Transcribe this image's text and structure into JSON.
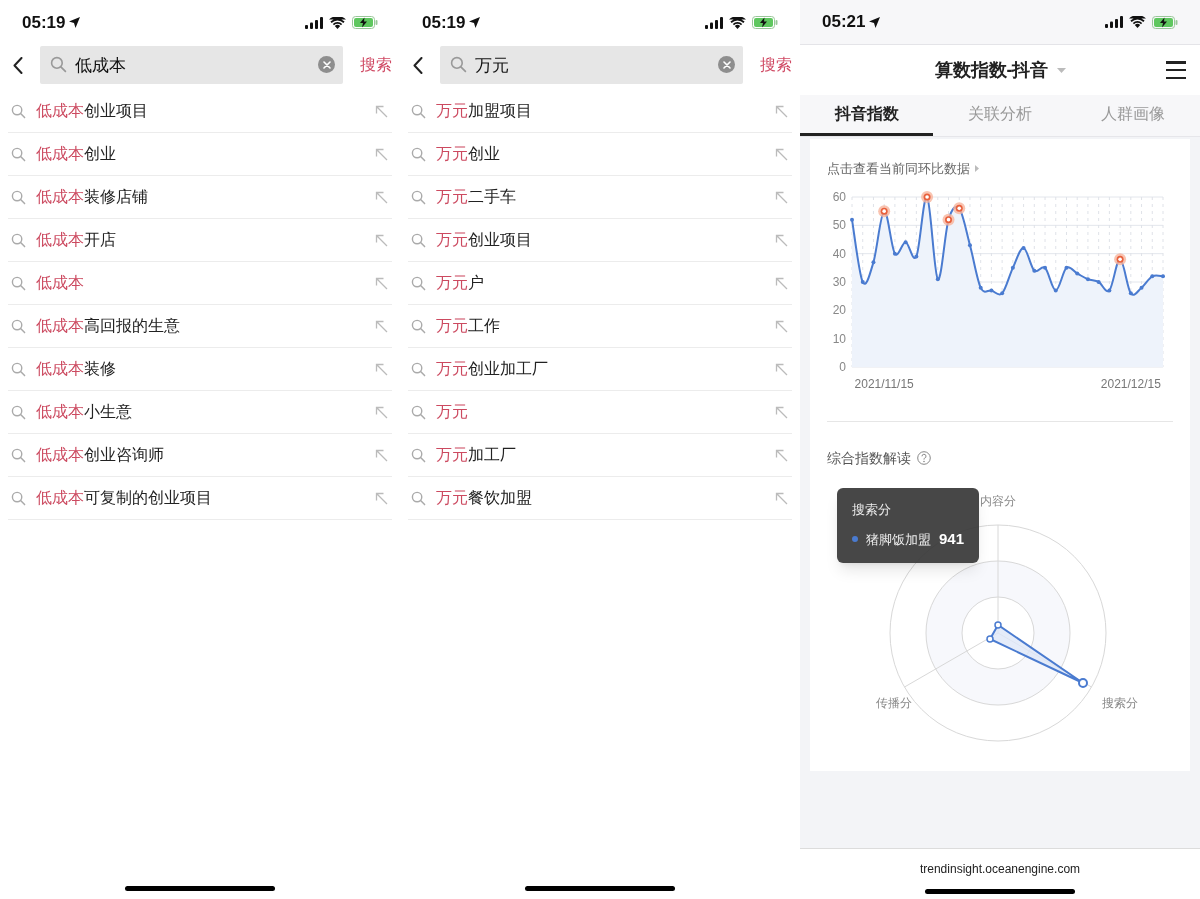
{
  "screens": [
    {
      "kind": "search",
      "status_bar": {
        "time": "05:19"
      },
      "search": {
        "value": "低成本"
      },
      "search_button": "搜索",
      "suggestions": [
        {
          "match": "低成本",
          "rest": "创业项目"
        },
        {
          "match": "低成本",
          "rest": "创业"
        },
        {
          "match": "低成本",
          "rest": "装修店铺"
        },
        {
          "match": "低成本",
          "rest": "开店"
        },
        {
          "match": "低成本"
        },
        {
          "match": "低成本",
          "rest": "高回报的生意"
        },
        {
          "match": "低成本",
          "rest": "装修"
        },
        {
          "match": "低成本",
          "rest": "小生意"
        },
        {
          "match": "低成本",
          "rest": "创业咨询师"
        },
        {
          "match": "低成本",
          "rest": "可复制的创业项目"
        }
      ]
    },
    {
      "kind": "search",
      "status_bar": {
        "time": "05:19"
      },
      "search": {
        "value": "万元"
      },
      "search_button": "搜索",
      "suggestions": [
        {
          "match": "万元",
          "rest": "加盟项目"
        },
        {
          "match": "万元",
          "rest": "创业"
        },
        {
          "match": "万元",
          "rest": "二手车"
        },
        {
          "match": "万元",
          "rest": "创业项目"
        },
        {
          "match": "万元",
          "rest": "户"
        },
        {
          "match": "万元",
          "rest": "工作"
        },
        {
          "match": "万元",
          "rest": "创业加工厂"
        },
        {
          "match": "万元"
        },
        {
          "match": "万元",
          "rest": "加工厂"
        },
        {
          "match": "万元",
          "rest": "餐饮加盟"
        }
      ]
    },
    {
      "kind": "index",
      "status_bar": {
        "time": "05:21"
      },
      "title": "算数指数-抖音",
      "tabs": [
        {
          "label": "抖音指数",
          "selected": true
        },
        {
          "label": "关联分析",
          "selected": false
        },
        {
          "label": "人群画像",
          "selected": false
        }
      ],
      "chart_link": "点击查看当前同环比数据",
      "chart_data": {
        "type": "area",
        "grid": true,
        "categories": [
          null,
          null,
          null,
          "2021/11/15",
          null,
          null,
          null,
          null,
          null,
          null,
          null,
          null,
          null,
          null,
          null,
          null,
          null,
          null,
          null,
          null,
          null,
          null,
          null,
          null,
          null,
          null,
          "2021/12/15",
          null,
          null,
          null
        ],
        "series": [
          {
            "color": "#4a7bd0",
            "values": [
              52,
              30,
              37,
              55,
              40,
              44,
              39,
              60,
              31,
              52,
              56,
              43,
              28,
              27,
              26,
              35,
              42,
              34,
              35,
              27,
              35,
              33,
              31,
              30,
              27,
              38,
              26,
              28,
              32,
              32
            ]
          }
        ],
        "ylim": [
          0,
          60
        ],
        "yticks": [
          0,
          10,
          20,
          30,
          40,
          50,
          60
        ],
        "title": null
      },
      "chart_markers": [
        false,
        false,
        false,
        true,
        false,
        false,
        false,
        true,
        false,
        true,
        true,
        false,
        false,
        false,
        false,
        false,
        false,
        false,
        false,
        false,
        false,
        false,
        false,
        false,
        false,
        true,
        false,
        false,
        false,
        false
      ],
      "section_title": "综合指数解读",
      "radar": {
        "axes": [
          "内容分",
          "传播分",
          "搜索分"
        ],
        "tooltip": {
          "title": "搜索分",
          "series": "猪脚饭加盟",
          "value": "941"
        }
      },
      "url": "trendinsight.oceanengine.com"
    }
  ]
}
